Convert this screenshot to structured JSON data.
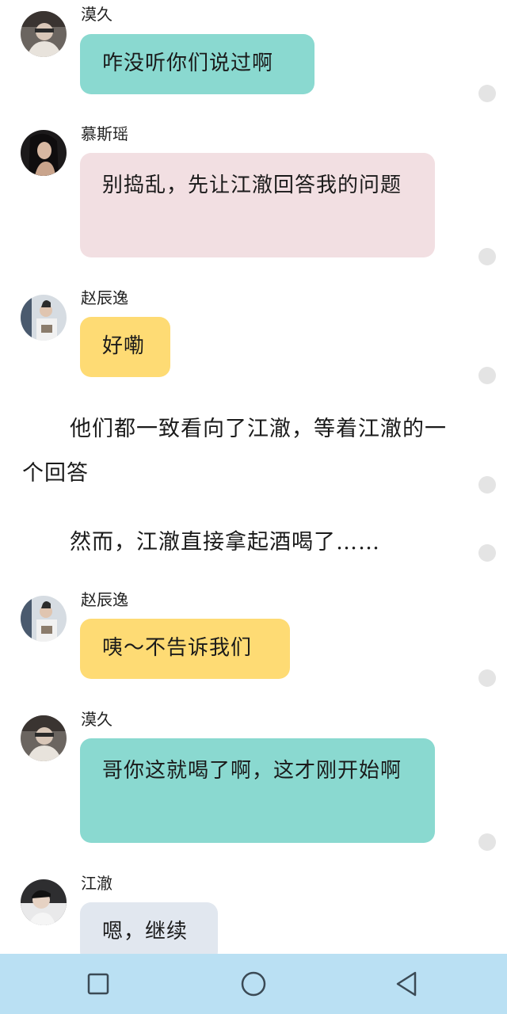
{
  "messages": [
    {
      "sender": "漠久",
      "text": "咋没听你们说过啊",
      "avatar": "avatar-mojiu",
      "color": "#8ad9d0"
    },
    {
      "sender": "慕斯瑶",
      "text": "别捣乱，先让江澈回答我的问题",
      "avatar": "avatar-musiyao",
      "color": "#f2dfe2"
    },
    {
      "sender": "赵辰逸",
      "text": "好嘞",
      "avatar": "avatar-zhaochenyi",
      "color": "#fedb74"
    },
    {
      "sender": "赵辰逸",
      "text": "咦～不告诉我们",
      "avatar": "avatar-zhaochenyi",
      "color": "#fedb74"
    },
    {
      "sender": "漠久",
      "text": "哥你这就喝了啊，这才刚开始啊",
      "avatar": "avatar-mojiu",
      "color": "#8ad9d0"
    },
    {
      "sender": "江澈",
      "text": "嗯，继续",
      "avatar": "avatar-jiangche",
      "color": "#e1e7ef"
    }
  ],
  "narration": [
    "他们都一致看向了江澈，等着江澈的一个回答",
    "然而，江澈直接拿起酒喝了……"
  ],
  "navbar": {
    "background": "#bae0f3",
    "buttons": [
      "recent-apps",
      "home",
      "back"
    ]
  }
}
